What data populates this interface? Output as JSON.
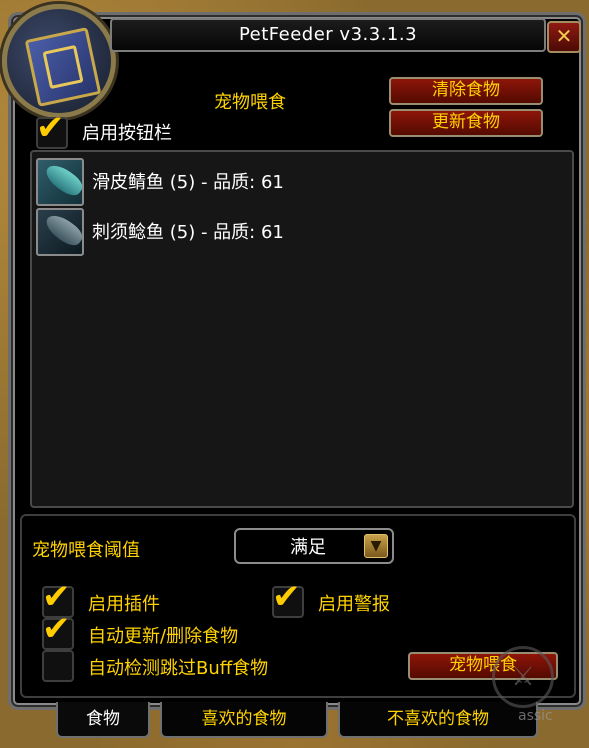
{
  "window": {
    "title": "PetFeeder v3.3.1.3",
    "close_label": "✕"
  },
  "header": {
    "section_label": "宠物喂食",
    "clear_food_label": "清除食物",
    "refresh_food_label": "更新食物",
    "enable_button_bar_label": "启用按钮栏",
    "enable_button_bar_checked": true
  },
  "food_list": [
    {
      "name": "滑皮鲭鱼 (5) - 品质: 61",
      "icon": "mackerel-fish-icon"
    },
    {
      "name": "刺须鲶鱼 (5) - 品质: 61",
      "icon": "catfish-icon"
    }
  ],
  "threshold": {
    "label": "宠物喂食阈值",
    "value": "满足",
    "dropdown_icon": "arrow-down-icon"
  },
  "options": {
    "enable_plugin": {
      "label": "启用插件",
      "checked": true
    },
    "enable_alert": {
      "label": "启用警报",
      "checked": true
    },
    "auto_update_delete": {
      "label": "自动更新/删除食物",
      "checked": true
    },
    "auto_detect_skip_buff": {
      "label": "自动检测跳过Buff食物",
      "checked": false
    },
    "feed_button_label": "宠物喂食"
  },
  "tabs": [
    {
      "label": "食物",
      "active": true
    },
    {
      "label": "喜欢的食物",
      "active": false
    },
    {
      "label": "不喜欢的食物",
      "active": false
    }
  ],
  "watermark": {
    "text": "assic"
  }
}
